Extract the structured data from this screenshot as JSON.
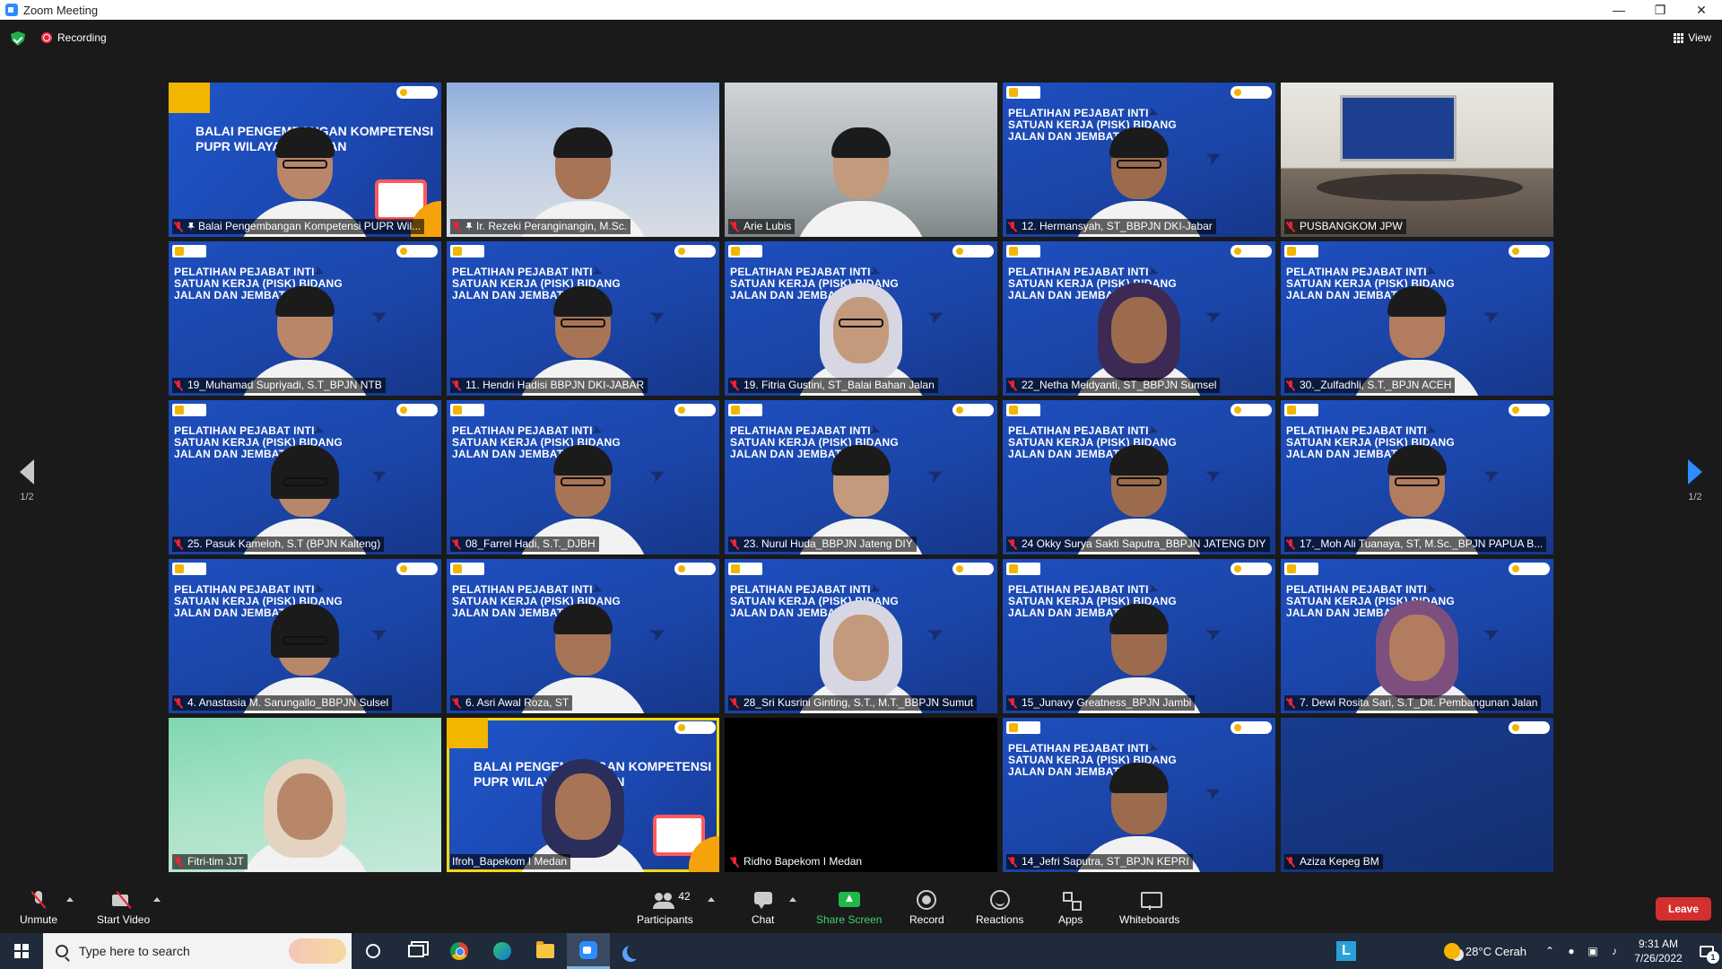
{
  "window": {
    "title": "Zoom Meeting"
  },
  "topbar": {
    "recording_label": "Recording",
    "view_label": "View"
  },
  "pager": {
    "left_label": "1/2",
    "right_label": "1/2"
  },
  "slide": {
    "pelatihan": "PELATIHAN PEJABAT INTI SATUAN KERJA (PISK) BIDANG JALAN DAN JEMBATAN",
    "balai": "BALAI PENGEMBANGAN KOMPETENSI PUPR WILAYAH I MEDAN"
  },
  "tiles": [
    {
      "name": "Balai Pengembangan Kompetensi PUPR Wil...",
      "bg": "balai",
      "pinned": true
    },
    {
      "name": "Ir. Rezeki Peranginangin, M.Sc.",
      "bg": "office",
      "pinned": true
    },
    {
      "name": "Arie Lubis",
      "bg": "street"
    },
    {
      "name": "12. Hermansyah, ST_BBPJN DKI-Jabar",
      "bg": "blue"
    },
    {
      "name": "PUSBANGKOM JPW",
      "bg": "room"
    },
    {
      "name": "19_Muhamad Supriyadi, S.T_BPJN NTB",
      "bg": "blue"
    },
    {
      "name": "11. Hendri Hadisi BBPJN DKI-JABAR",
      "bg": "blue"
    },
    {
      "name": "19. Fitria Gustini, ST_Balai Bahan Jalan",
      "bg": "blue"
    },
    {
      "name": "22_Netha Meidyanti, ST_BBPJN Sumsel",
      "bg": "blue"
    },
    {
      "name": "30._Zulfadhli, S.T._BPJN ACEH",
      "bg": "blue"
    },
    {
      "name": "25. Pasuk Kameloh, S.T (BPJN Kalteng)",
      "bg": "blue"
    },
    {
      "name": "08_Farrel Hadi, S.T._DJBH",
      "bg": "blue"
    },
    {
      "name": "23. Nurul Huda_BBPJN Jateng DIY",
      "bg": "blue"
    },
    {
      "name": "24 Okky Surya Sakti Saputra_BBPJN JATENG DIY",
      "bg": "blue"
    },
    {
      "name": "17._Moh Ali Tuanaya, ST, M.Sc._BPJN PAPUA B...",
      "bg": "blue"
    },
    {
      "name": "4. Anastasia M. Sarungallo_BBPJN Sulsel",
      "bg": "blue"
    },
    {
      "name": "6. Asri Awal Roza, ST",
      "bg": "blue"
    },
    {
      "name": "28_Sri Kusrini Ginting, S.T., M.T._BBPJN Sumut",
      "bg": "blue"
    },
    {
      "name": "15_Junavy Greatness_BPJN Jambi",
      "bg": "blue"
    },
    {
      "name": "7. Dewi Rosita Sari, S.T_Dit. Pembangunan Jalan",
      "bg": "blue"
    },
    {
      "name": "Fitri-tim JJT",
      "bg": "lightgreen"
    },
    {
      "name": "Ifroh_Bapekom I Medan",
      "bg": "balai",
      "active": true,
      "mic_on": true
    },
    {
      "name": "Ridho Bapekom I Medan",
      "bg": "black"
    },
    {
      "name": "14_Jefri Saputra, ST_BPJN KEPRI",
      "bg": "blue"
    },
    {
      "name": "Aziza Kepeg BM",
      "bg": "navy"
    }
  ],
  "toolbar": {
    "unmute": "Unmute",
    "start_video": "Start Video",
    "participants": "Participants",
    "participants_count": "42",
    "chat": "Chat",
    "share_screen": "Share Screen",
    "record": "Record",
    "reactions": "Reactions",
    "apps": "Apps",
    "whiteboards": "Whiteboards",
    "leave": "Leave"
  },
  "taskbar": {
    "search_placeholder": "Type here to search",
    "weather": "28°C  Cerah",
    "time": "9:31 AM",
    "date": "7/26/2022",
    "notif_count": "1"
  },
  "colors": {
    "accent": "#2d8cff",
    "share_green": "#41d36a",
    "leave_red": "#d32f2f",
    "active_border": "#f5d90a"
  }
}
